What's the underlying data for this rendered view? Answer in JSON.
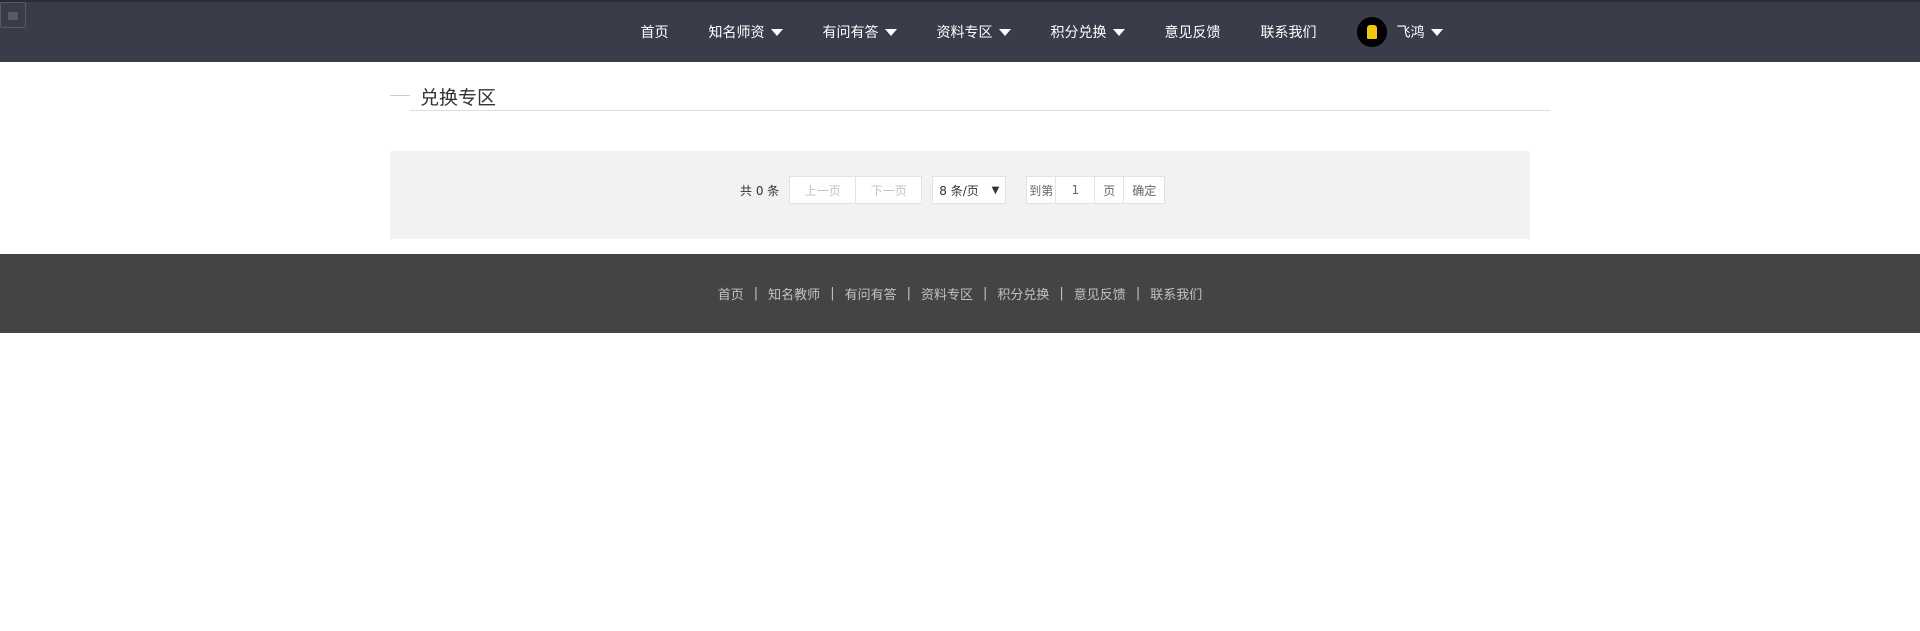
{
  "nav": {
    "items": [
      {
        "label": "首页",
        "dropdown": false
      },
      {
        "label": "知名师资",
        "dropdown": true
      },
      {
        "label": "有问有答",
        "dropdown": true
      },
      {
        "label": "资料专区",
        "dropdown": true
      },
      {
        "label": "积分兑换",
        "dropdown": true
      },
      {
        "label": "意见反馈",
        "dropdown": false
      },
      {
        "label": "联系我们",
        "dropdown": false
      }
    ],
    "user": {
      "name": "飞鸿"
    }
  },
  "section": {
    "title": "兑换专区"
  },
  "pager": {
    "total": "共 0 条",
    "prev": "上一页",
    "next": "下一页",
    "page_size": "8 条/页",
    "goto_label": "到第",
    "page_value": "1",
    "page_unit": "页",
    "confirm": "确定"
  },
  "footer": {
    "links": [
      "首页",
      "知名教师",
      "有问有答",
      "资料专区",
      "积分兑换",
      "意见反馈",
      "联系我们"
    ],
    "separator": "|"
  },
  "colors": {
    "topbar": "#393d49",
    "footer": "#444444",
    "pager_bg": "#f2f2f2"
  }
}
